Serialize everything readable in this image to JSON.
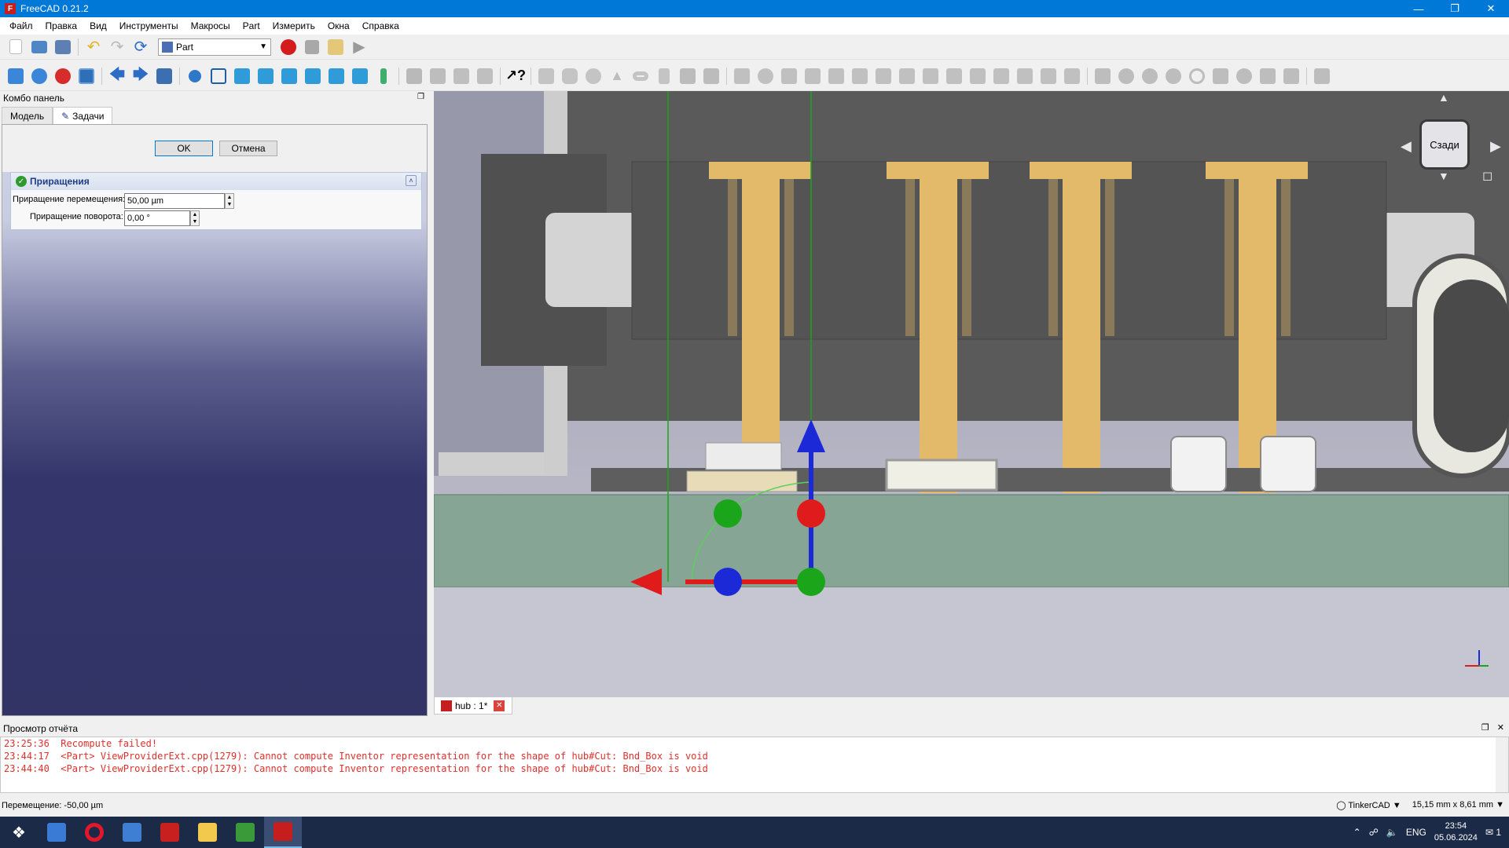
{
  "window": {
    "title": "FreeCAD 0.21.2"
  },
  "menu": [
    "Файл",
    "Правка",
    "Вид",
    "Инструменты",
    "Макросы",
    "Part",
    "Измерить",
    "Окна",
    "Справка"
  ],
  "toolbar": {
    "workbench": "Part"
  },
  "combo_panel": {
    "title": "Комбо панель",
    "tabs": [
      "Модель",
      "Задачи"
    ],
    "active_tab": "Задачи",
    "ok_label": "OK",
    "cancel_label": "Отмена",
    "increments": {
      "title": "Приращения",
      "move_label": "Приращение перемещения:",
      "move_value": "50,00 µm",
      "rotate_label": "Приращение поворота:",
      "rotate_value": "0,00 °"
    }
  },
  "navicube": {
    "face": "Сзади"
  },
  "doc_tab": {
    "label": "hub : 1*"
  },
  "report": {
    "title": "Просмотр отчёта",
    "lines": [
      "23:25:36  Recompute failed!",
      "23:44:17  <Part> ViewProviderExt.cpp(1279): Cannot compute Inventor representation for the shape of hub#Cut: Bnd_Box is void",
      "23:44:40  <Part> ViewProviderExt.cpp(1279): Cannot compute Inventor representation for the shape of hub#Cut: Bnd_Box is void"
    ]
  },
  "status": {
    "message": "Перемещение: -50,00 µm",
    "nav_style": "TinkerCAD",
    "dimensions": "15,15 mm x 8,61 mm"
  },
  "taskbar": {
    "lang": "ENG",
    "time": "23:54",
    "date": "05.06.2024",
    "notifications": "1"
  },
  "colors": {
    "titlebar": "#0078d7",
    "pcb_green": "#86a595",
    "pin_gold": "#e3b96a",
    "body_gray": "#585858",
    "axis_red": "#e01b1b",
    "axis_green": "#1aa51a",
    "axis_blue": "#1b2ad6"
  }
}
